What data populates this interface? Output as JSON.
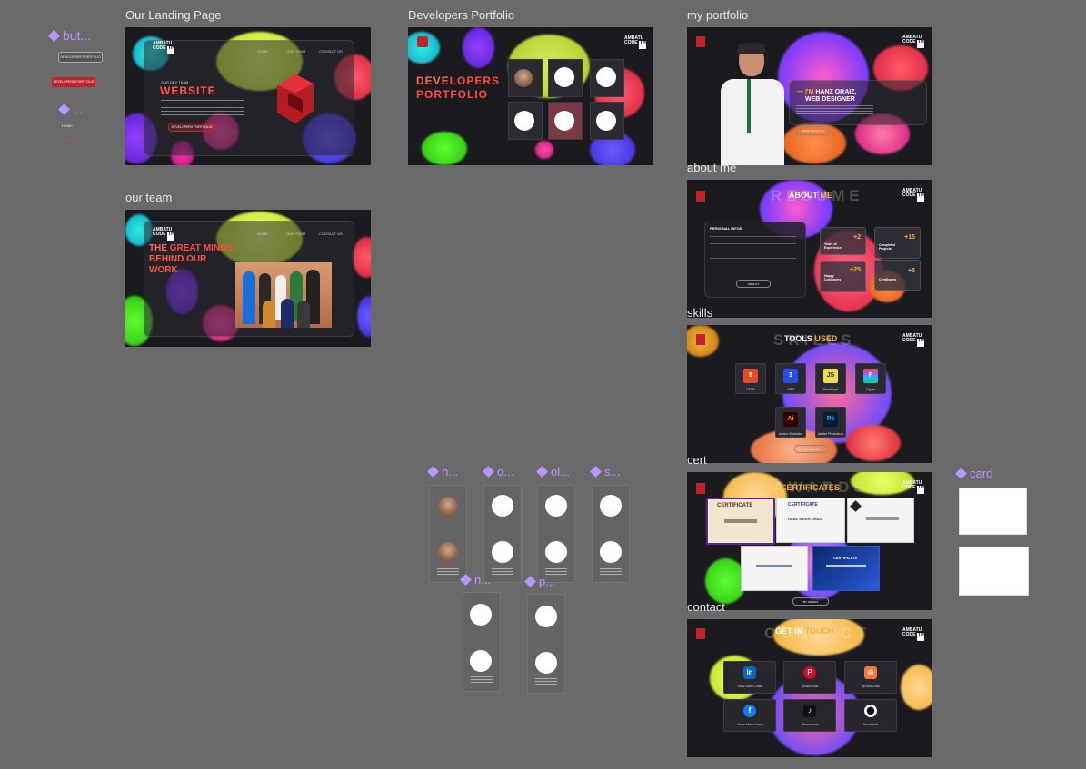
{
  "frames": {
    "landing": {
      "label": "Our Landing Page",
      "nav": [
        "HOME",
        "OUR TEAM",
        "CONTACT US"
      ],
      "small_heading": "OUR DEV TEAM",
      "title": "WEBSITE",
      "button": "DEVELOPERS PORTFOLIO"
    },
    "team": {
      "label": "our team",
      "nav": [
        "HOME",
        "OUR TEAM",
        "CONTACT US"
      ],
      "heading_white_1": "THE ",
      "heading_red_1": "GREAT MINDS",
      "heading_line_2": "BEHIND OUR",
      "heading_line_3": "WORK"
    },
    "devs": {
      "label": "Developers Portfolio",
      "nav": [
        "HOME",
        "OUR TEAM",
        "CONTACT US"
      ],
      "title_white": "DEVE",
      "title_red": "LOPERS",
      "title_line2": "PORTFOLIO"
    },
    "portfolio": {
      "label": "my portfolio",
      "intro_prefix": "— I'M ",
      "intro_name": "HANZ ORAIZ,",
      "intro_role": "WEB DESIGNER",
      "button": "MORE ABOUT ME"
    },
    "about": {
      "label": "about me",
      "bg_word": "RESUME",
      "title_white": "ABOUT ",
      "title_gold": "ME",
      "info_title": "PERSONAL INFOS",
      "button": "VIEW CV",
      "stats": [
        {
          "value": "+2",
          "label": "Years of Experience"
        },
        {
          "value": "+15",
          "label": "Completed Projects"
        },
        {
          "value": "+25",
          "label": "Happy Customers"
        },
        {
          "value": "+5",
          "label": "Certificates"
        }
      ]
    },
    "skills": {
      "label": "skills",
      "bg_word": "SKILLS",
      "title_white": "TOOLS ",
      "title_gold": "USED",
      "button": "MY WORKS",
      "tools": [
        {
          "name": "HTML",
          "icon": "html-icon",
          "symbol": "5",
          "color": "#e34c26"
        },
        {
          "name": "CSS",
          "icon": "css-icon",
          "symbol": "3",
          "color": "#264de4"
        },
        {
          "name": "JavaScript",
          "icon": "javascript-icon",
          "symbol": "JS",
          "color": "#f0db4f"
        },
        {
          "name": "Figma",
          "icon": "figma-icon",
          "symbol": "F",
          "color": "#222"
        },
        {
          "name": "Adobe Illustrator",
          "icon": "illustrator-icon",
          "symbol": "Ai",
          "color": "#330000"
        },
        {
          "name": "Adobe Photoshop",
          "icon": "photoshop-icon",
          "symbol": "Ps",
          "color": "#001e36"
        }
      ]
    },
    "cert": {
      "label": "cert",
      "bg_word": "AWARDS",
      "title": "CERTIFICATES",
      "cert_heading": "CERTIFICATE",
      "cert_name": "HANZ AIKEN ORAIZ",
      "button": "MY WORKS"
    },
    "contact": {
      "label": "contact",
      "bg_word": "CONTACT",
      "title_white": "GET IN ",
      "title_gold": "TOUCH",
      "socials": [
        {
          "name": "Hanz Aiken Oraiz",
          "icon": "linkedin-icon",
          "symbol": "in",
          "color": "#0a66c2"
        },
        {
          "name": "@hanzoraiz",
          "icon": "pinterest-icon",
          "symbol": "P",
          "color": "#e60023"
        },
        {
          "name": "@HanzOraiz",
          "icon": "instagram-icon",
          "symbol": "◎",
          "color": "#f77737"
        },
        {
          "name": "Hanz Aiken Oraiz",
          "icon": "facebook-icon",
          "symbol": "f",
          "color": "#1877f2"
        },
        {
          "name": "@hanzoraiz",
          "icon": "tiktok-icon",
          "symbol": "♪",
          "color": "#111"
        },
        {
          "name": "HanzOraiz",
          "icon": "github-icon",
          "symbol": "⬤",
          "color": "#222"
        }
      ]
    }
  },
  "components": {
    "buttons": {
      "label": "but...",
      "item1": "DEVELOPERS PORTFOLIO",
      "item2": "DEVELOPERS PORTFOLIO"
    },
    "nav_comp": {
      "label": "...",
      "item1": "HOME",
      "item2": "HOME"
    },
    "h": {
      "label": "h..."
    },
    "o": {
      "label": "o..."
    },
    "ol": {
      "label": "ol..."
    },
    "s": {
      "label": "s..."
    },
    "n": {
      "label": "n..."
    },
    "p": {
      "label": "p..."
    },
    "card": {
      "label": "card"
    }
  },
  "colors": {
    "canvas": "#6a6a6a",
    "frame_bg": "#1b1b1f",
    "accent_red": "#e8453c",
    "accent_gold": "#f2b233",
    "component_purple": "#b896ff"
  }
}
